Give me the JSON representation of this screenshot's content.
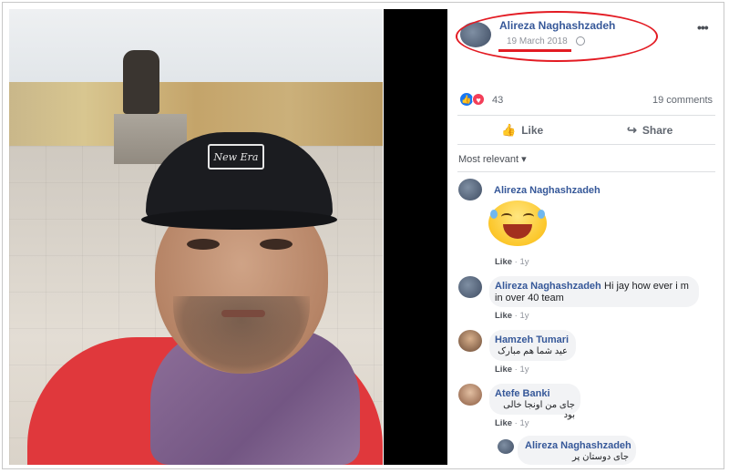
{
  "post": {
    "author": "Alireza Naghashzadeh",
    "date": "19 March 2018",
    "privacy_icon": "globe-icon",
    "more_icon": "more-options-icon",
    "reactions_count": "43",
    "comments_count": "19 comments",
    "like_label": "Like",
    "share_label": "Share",
    "sort_label": "Most relevant ▾",
    "cap_logo_text": "New Era"
  },
  "comments": [
    {
      "name": "Alireza Naghashzadeh",
      "text": "",
      "like": "Like",
      "time": "1y"
    },
    {
      "name": "Alireza Naghashzadeh",
      "text_line1": "Hi jay how ever i m",
      "text_line2": "in over 40 team",
      "like": "Like",
      "time": "1y"
    },
    {
      "name": "Hamzeh Tumari",
      "text": "عید شما هم مبارک",
      "like": "Like",
      "time": "1y"
    },
    {
      "name": "Atefe Banki",
      "text": "جای من اونجا خالی بود",
      "like": "Like",
      "time": "1y"
    },
    {
      "name": "Alireza Naghashzadeh",
      "text": "جای دوستان پر"
    }
  ],
  "colors": {
    "link_blue": "#365899",
    "annotation_red": "#e31b23",
    "like_blue": "#1877f2",
    "love_red": "#f33e58"
  }
}
